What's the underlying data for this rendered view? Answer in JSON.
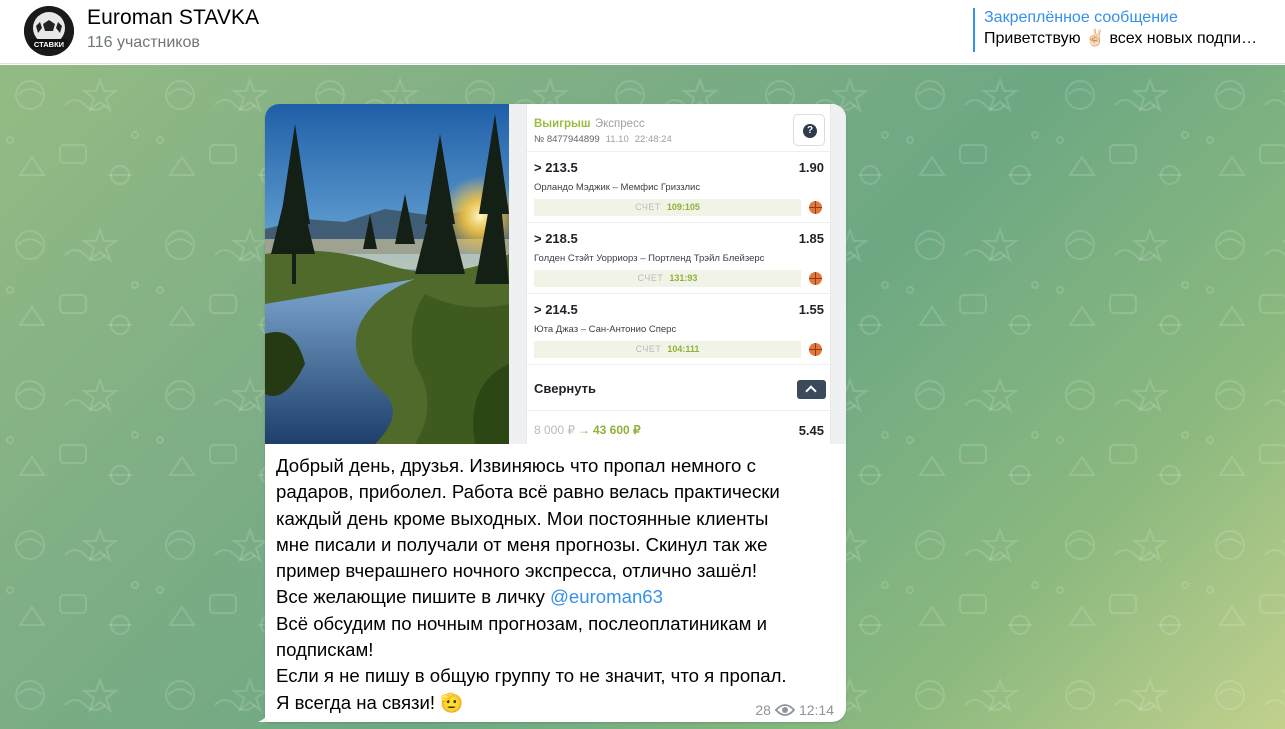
{
  "header": {
    "channel_name": "Euroman STAVKA",
    "subscribers": "116 участников",
    "avatar_text": "СТАВКИ",
    "pinned": {
      "title": "Закреплённое сообщение",
      "text": "Приветствую ✌🏻 всех новых подпи…"
    }
  },
  "message": {
    "bet_slip": {
      "status": "Выигрыш",
      "type": "Экспресс",
      "number": "№ 8477944899",
      "date": "11.10",
      "time": "22:48:24",
      "help": "?",
      "bets": [
        {
          "line": "> 213.5",
          "odd": "1.90",
          "teams": "Орландо Мэджик – Мемфис Гриззлис",
          "score_label": "СЧЕТ",
          "score": "109:105"
        },
        {
          "line": "> 218.5",
          "odd": "1.85",
          "teams": "Голден Стэйт Уорриорз – Портленд Трэйл Блейзерс",
          "score_label": "СЧЕТ",
          "score": "131:93"
        },
        {
          "line": "> 214.5",
          "odd": "1.55",
          "teams": "Юта Джаз – Сан-Антонио Сперс",
          "score_label": "СЧЕТ",
          "score": "104:111"
        }
      ],
      "collapse_label": "Свернуть",
      "stake": "8 000 ₽",
      "arrow": "→",
      "payout": "43 600 ₽",
      "total_odd": "5.45"
    },
    "text_lines": {
      "l1": "Добрый день, друзья. Извиняюсь что пропал немного с",
      "l2": "радаров, приболел. Работа всё равно велась практически",
      "l3": "каждый день кроме выходных. Мои постоянные клиенты",
      "l4": "мне писали и получали от меня прогнозы. Скинул так же",
      "l5": "пример вчерашнего ночного экспресса, отлично зашёл!",
      "l6_prefix": "Все желающие пишите в личку ",
      "l6_mention": "@euroman63",
      "l7": "Всё обсудим по ночным прогнозам, послеоплатиникам и",
      "l8": "подпискам!",
      "l9": "Если я не пишу в общую группу то не значит, что я пропал.",
      "l10": "Я всегда на связи! 🫡"
    },
    "views": "28",
    "time": "12:14"
  },
  "colors": {
    "accent": "#3390ec",
    "win_green": "#9bbd3f",
    "chat_bg": "#7fae85"
  }
}
